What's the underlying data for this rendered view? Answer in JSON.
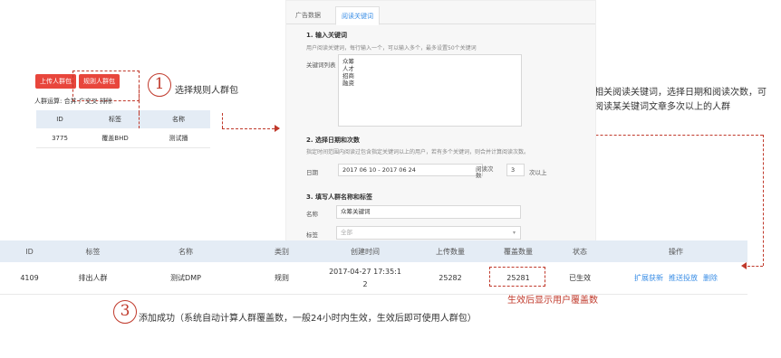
{
  "mini_panel": {
    "upload_button": "上传人群包",
    "rule_button": "规则人群包",
    "ops_label": "人群运算:",
    "ops_items": "合并 广交叉 排除",
    "columns": [
      "ID",
      "标签",
      "名称"
    ],
    "row": [
      "3775",
      "覆盖BHD",
      "测试播"
    ]
  },
  "callouts": {
    "one": {
      "num": "1",
      "text": "选择规则人群包"
    },
    "two": {
      "num": "2",
      "line1": "输入相关阅读关键词，选择日期和阅读次数，可",
      "line2": "生成阅读某关键词文章多次以上的人群"
    },
    "three": {
      "num": "3",
      "text": "添加成功（系统自动计算人群覆盖数，一般24小时内生效，生效后即可使用人群包）"
    },
    "coverage_note": "生效后显示用户覆盖数"
  },
  "form": {
    "tabs": [
      "广告数据",
      "阅读关键词"
    ],
    "section1_title": "1. 输入关键词",
    "section1_desc": "用户阅读关键词，每行输入一个，可以输入多个，最多设置50个关键词",
    "keywords_label": "关键词列表",
    "keywords": [
      "众筹",
      "人才",
      "招商",
      "融资"
    ],
    "section2_title": "2. 选择日期和次数",
    "section2_desc": "指定时间范围内阅读过包含指定关键词以上的用户，若有多个关键词，则合并计算阅读次数。",
    "date_label": "日期",
    "date_value": "2017 06 10 - 2017 06 24",
    "read_count_label": "阅读次数",
    "read_count_value": "3",
    "read_count_suffix": "次以上",
    "section3_title": "3. 填写人群名称和标签",
    "name_label": "名称",
    "name_value": "众筹关键词",
    "tag_label": "标签",
    "tag_value": "全部"
  },
  "main_table": {
    "columns": [
      "ID",
      "标签",
      "名称",
      "类别",
      "创建时间",
      "上传数量",
      "覆盖数量",
      "状态",
      "操作"
    ],
    "row": {
      "id": "4109",
      "tag": "排出人群",
      "name": "测试DMP",
      "type": "规则",
      "created_line1": "2017-04-27 17:35:1",
      "created_line2": "2",
      "upload_count": "25282",
      "coverage_count": "25281",
      "status": "已生效",
      "ops": [
        "扩展获新",
        "推送投放",
        "删除"
      ]
    }
  }
}
